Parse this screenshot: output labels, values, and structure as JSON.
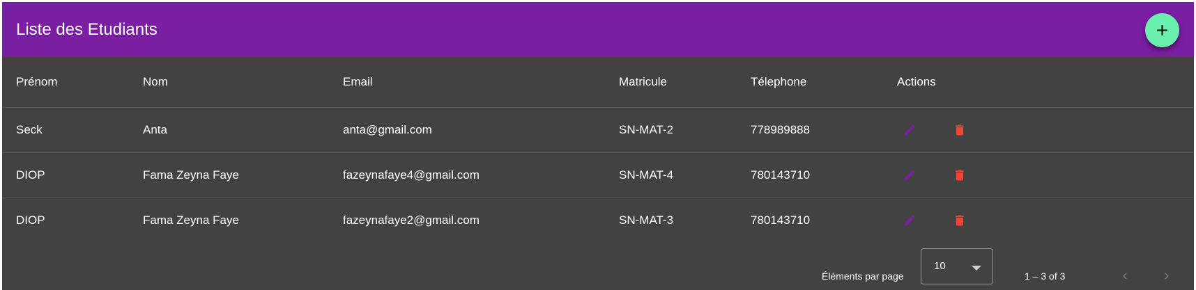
{
  "toolbar": {
    "title": "Liste des Etudiants",
    "add_icon": "plus-icon",
    "fab_color": "#69f0ae",
    "bg_color": "#7b1fa2"
  },
  "table": {
    "columns": [
      "Prénom",
      "Nom",
      "Email",
      "Matricule",
      "Télephone",
      "Actions"
    ],
    "rows": [
      {
        "prenom": "Seck",
        "nom": "Anta",
        "email": "anta@gmail.com",
        "matricule": "SN-MAT-2",
        "telephone": "778989888"
      },
      {
        "prenom": "DIOP",
        "nom": "Fama Zeyna Faye",
        "email": "fazeynafaye4@gmail.com",
        "matricule": "SN-MAT-4",
        "telephone": "780143710"
      },
      {
        "prenom": "DIOP",
        "nom": "Fama Zeyna Faye",
        "email": "fazeynafaye2@gmail.com",
        "matricule": "SN-MAT-3",
        "telephone": "780143710"
      }
    ],
    "edit_icon": "pencil-icon",
    "delete_icon": "trash-icon",
    "edit_color": "#7b1fa2",
    "delete_color": "#f44336"
  },
  "paginator": {
    "page_size_label": "Éléments par page",
    "page_size": "10",
    "range_label": "1 – 3 of 3",
    "prev_icon": "chevron-left-icon",
    "next_icon": "chevron-right-icon"
  }
}
